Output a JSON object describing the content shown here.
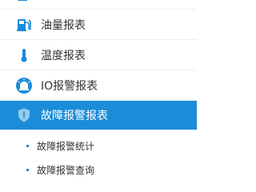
{
  "menu": {
    "items": [
      {
        "label": "",
        "icon": "fuel-partial-icon"
      },
      {
        "label": "油量报表",
        "icon": "fuel-pump-icon"
      },
      {
        "label": "温度报表",
        "icon": "thermometer-icon"
      },
      {
        "label": "IO报警报表",
        "icon": "io-alarm-icon"
      },
      {
        "label": "故障报警报表",
        "icon": "shield-alert-icon",
        "active": true
      }
    ],
    "subitems": [
      {
        "label": "故障报警统计"
      },
      {
        "label": "故障报警查询"
      }
    ]
  },
  "colors": {
    "accent": "#1a8cd8",
    "text": "#333333",
    "active_text": "#ffffff",
    "divider": "#eeeeee"
  }
}
